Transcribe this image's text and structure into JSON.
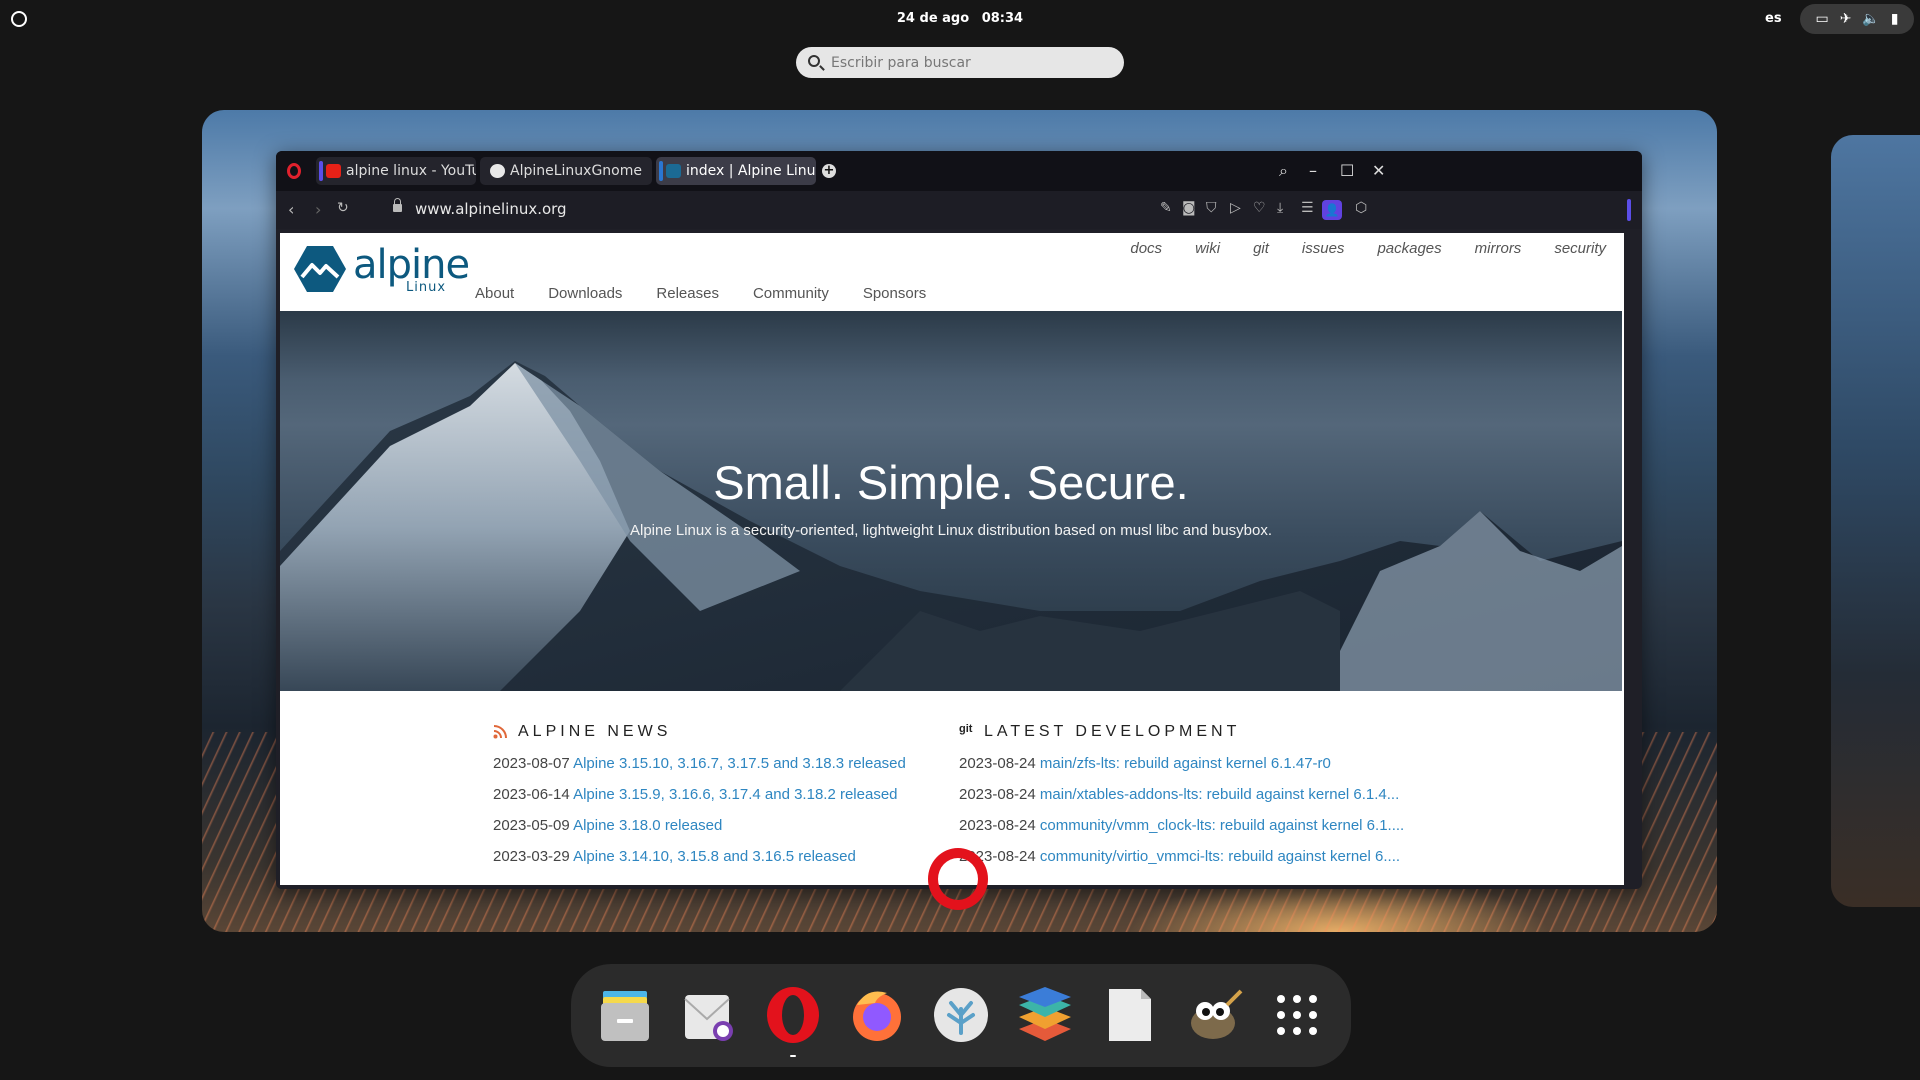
{
  "topbar": {
    "date": "24 de ago",
    "time": "08:34",
    "keyboard_layout": "es",
    "tray_icons": [
      "display-icon",
      "airplane-icon",
      "volume-icon",
      "battery-icon"
    ]
  },
  "search": {
    "placeholder": "Escribir para buscar"
  },
  "browser": {
    "tabs": [
      {
        "label": "alpine linux - YouTu",
        "favicon": "youtube-icon"
      },
      {
        "label": "AlpineLinuxGnome",
        "favicon": "github-icon"
      },
      {
        "label": "index | Alpine Linux",
        "favicon": "alpine-icon",
        "active": true
      }
    ],
    "url": "www.alpinelinux.org"
  },
  "page": {
    "logo_text": "alpine",
    "logo_sub": "Linux",
    "top_links": [
      "docs",
      "wiki",
      "git",
      "issues",
      "packages",
      "mirrors",
      "security"
    ],
    "main_nav": [
      "About",
      "Downloads",
      "Releases",
      "Community",
      "Sponsors"
    ],
    "hero_title": "Small. Simple. Secure.",
    "hero_subtitle": "Alpine Linux is a security-oriented, lightweight Linux distribution based on musl libc and busybox.",
    "news": {
      "title": "ALPINE NEWS",
      "items": [
        {
          "date": "2023-08-07",
          "text": "Alpine 3.15.10, 3.16.7, 3.17.5 and 3.18.3 released"
        },
        {
          "date": "2023-06-14",
          "text": "Alpine 3.15.9, 3.16.6, 3.17.4 and 3.18.2 released"
        },
        {
          "date": "2023-05-09",
          "text": "Alpine 3.18.0 released"
        },
        {
          "date": "2023-03-29",
          "text": "Alpine 3.14.10, 3.15.8 and 3.16.5 released"
        }
      ]
    },
    "dev": {
      "label": "git",
      "title": "LATEST DEVELOPMENT",
      "items": [
        {
          "date": "2023-08-24",
          "text": "main/zfs-lts: rebuild against kernel 6.1.47-r0"
        },
        {
          "date": "2023-08-24",
          "text": "main/xtables-addons-lts: rebuild against kernel 6.1.4..."
        },
        {
          "date": "2023-08-24",
          "text": "community/vmm_clock-lts: rebuild against kernel 6.1...."
        },
        {
          "date": "2023-08-24",
          "text": "community/virtio_vmmci-lts: rebuild against kernel 6...."
        }
      ]
    }
  },
  "dock": {
    "apps": [
      "files-icon",
      "mail-icon",
      "opera-icon",
      "firefox-icon",
      "extension-icon",
      "layers-icon",
      "text-editor-icon",
      "gimp-icon",
      "app-grid-icon"
    ]
  },
  "colors": {
    "link": "#2e86c1",
    "alpine_blue": "#0d597f",
    "opera_red": "#e3121c",
    "accent": "#5b4ee8"
  }
}
